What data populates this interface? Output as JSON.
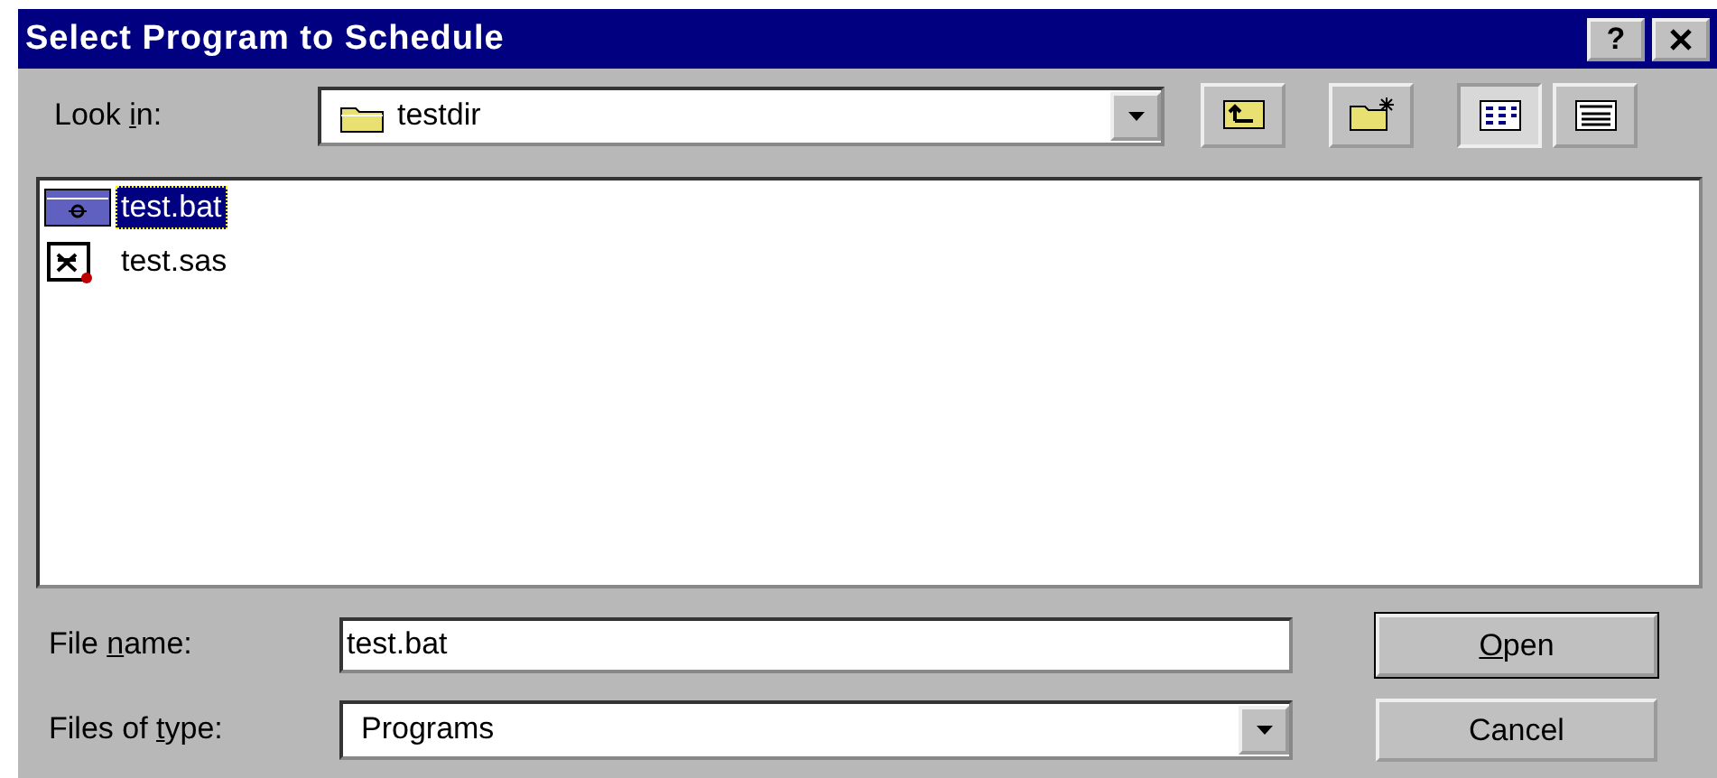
{
  "window": {
    "title": "Select Program to Schedule",
    "help_button": "?"
  },
  "look_in": {
    "label": {
      "before": "Look ",
      "key": "i",
      "after": "n:"
    },
    "value": "testdir"
  },
  "files": [
    {
      "name": "test.bat",
      "kind": "batch",
      "selected": true
    },
    {
      "name": "test.sas",
      "kind": "sas",
      "selected": false
    }
  ],
  "file_name": {
    "label": {
      "before": "File ",
      "key": "n",
      "after": "ame:"
    },
    "value": "test.bat"
  },
  "file_type": {
    "label": {
      "before": "Files of ",
      "key": "t",
      "after": "ype:"
    },
    "value": "Programs"
  },
  "buttons": [
    {
      "label": {
        "key": "O",
        "after": "pen"
      },
      "default": true
    },
    {
      "label": {
        "before": "Cancel"
      },
      "default": false
    }
  ]
}
